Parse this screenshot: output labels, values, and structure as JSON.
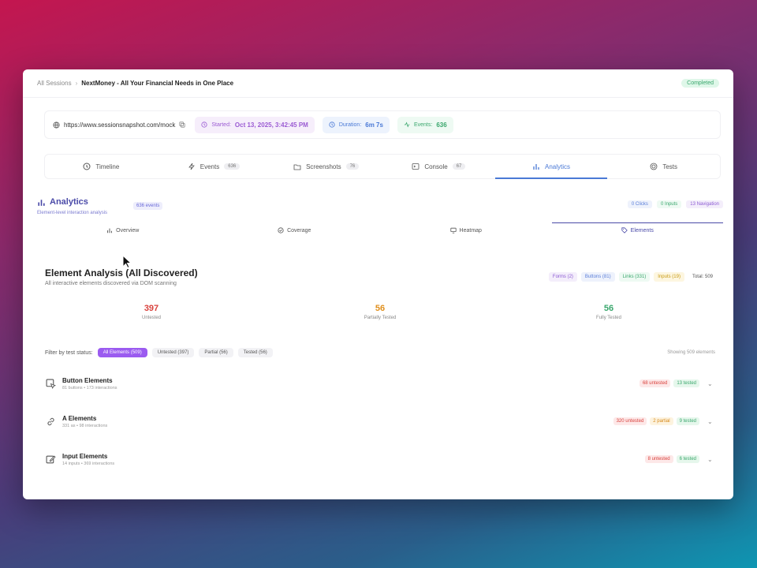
{
  "breadcrumb": {
    "root": "All Sessions",
    "title": "NextMoney - All Your Financial Needs in One Place",
    "status": "Completed"
  },
  "info": {
    "url": "https://www.sessionsnapshot.com/mock",
    "started_label": "Started:",
    "started_value": "Oct 13, 2025, 3:42:45 PM",
    "duration_label": "Duration:",
    "duration_value": "6m 7s",
    "events_label": "Events:",
    "events_value": "636"
  },
  "tabs": [
    {
      "label": "Timeline",
      "icon": "clock-icon"
    },
    {
      "label": "Events",
      "count": "636",
      "icon": "bolt-icon"
    },
    {
      "label": "Screenshots",
      "count": "76",
      "icon": "folder-icon"
    },
    {
      "label": "Console",
      "count": "67",
      "icon": "terminal-icon"
    },
    {
      "label": "Analytics",
      "icon": "bar-chart-icon",
      "active": true
    },
    {
      "label": "Tests",
      "icon": "target-icon"
    }
  ],
  "analytics": {
    "title": "Analytics",
    "subtitle": "Element-level interaction analysis",
    "badge": "636 events",
    "stats": {
      "clicks": "0 Clicks",
      "inputs": "0 Inputs",
      "navigation": "13 Navigation"
    },
    "subtabs": [
      {
        "label": "Overview",
        "icon": "bar-chart-icon"
      },
      {
        "label": "Coverage",
        "icon": "check-circle-icon"
      },
      {
        "label": "Heatmap",
        "icon": "monitor-icon"
      },
      {
        "label": "Elements",
        "icon": "tag-icon",
        "active": true
      }
    ]
  },
  "element_analysis": {
    "title": "Element Analysis (All Discovered)",
    "subtitle": "All interactive elements discovered via DOM scanning",
    "types": {
      "forms": "Forms (2)",
      "buttons": "Buttons (81)",
      "links": "Links (331)",
      "inputs": "Inputs (19)",
      "total": "Total: 509"
    },
    "summary": [
      {
        "value": "397",
        "caption": "Untested",
        "color": "#d9423d"
      },
      {
        "value": "56",
        "caption": "Partially Tested",
        "color": "#e08f1c"
      },
      {
        "value": "56",
        "caption": "Fully Tested",
        "color": "#3aa76d"
      }
    ],
    "filter": {
      "label": "Filter by test status:",
      "options": [
        "All Elements (509)",
        "Untested (397)",
        "Partial (56)",
        "Tested (56)"
      ],
      "showing": "Showing 509 elements"
    },
    "groups": [
      {
        "name": "Button Elements",
        "meta": "81 buttons • 173 interactions",
        "icon": "pointer-icon",
        "pills": [
          {
            "text": "68 untested",
            "kind": "red"
          },
          {
            "text": "13 tested",
            "kind": "green"
          }
        ]
      },
      {
        "name": "A Elements",
        "meta": "331 as • 98 interactions",
        "icon": "link-icon",
        "pills": [
          {
            "text": "320 untested",
            "kind": "red"
          },
          {
            "text": "2 partial",
            "kind": "orange"
          },
          {
            "text": "9 tested",
            "kind": "green"
          }
        ]
      },
      {
        "name": "Input Elements",
        "meta": "14 inputs • 369 interactions",
        "icon": "edit-icon",
        "pills": [
          {
            "text": "8 untested",
            "kind": "red"
          },
          {
            "text": "6 tested",
            "kind": "green"
          }
        ]
      }
    ]
  }
}
